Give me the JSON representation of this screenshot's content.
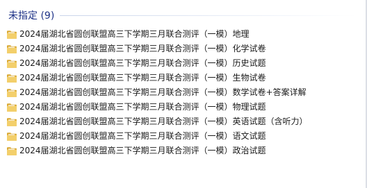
{
  "group": {
    "title": "未指定 (9)"
  },
  "files": [
    {
      "name": "2024届湖北省圆创联盟高三下学期三月联合测评（一模）地理",
      "icon": "folder-icon"
    },
    {
      "name": "2024届湖北省圆创联盟高三下学期三月联合测评（一模）化学试卷",
      "icon": "folder-icon"
    },
    {
      "name": "2024届湖北省圆创联盟高三下学期三月联合测评（一模）历史试题",
      "icon": "folder-icon"
    },
    {
      "name": "2024届湖北省圆创联盟高三下学期三月联合测评（一模）生物试卷",
      "icon": "folder-icon"
    },
    {
      "name": "2024届湖北省圆创联盟高三下学期三月联合测评（一模）数学试卷+答案详解",
      "icon": "folder-icon"
    },
    {
      "name": "2024届湖北省圆创联盟高三下学期三月联合测评（一模）物理试题",
      "icon": "folder-icon"
    },
    {
      "name": "2024届湖北省圆创联盟高三下学期三月联合测评（一模）英语试题（含听力）",
      "icon": "folder-icon"
    },
    {
      "name": "2024届湖北省圆创联盟高三下学期三月联合测评（一模）语文试题",
      "icon": "folder-icon"
    },
    {
      "name": "2024届湖北省圆创联盟高三下学期三月联合测评（一模）政治试题",
      "icon": "folder-icon"
    }
  ],
  "colors": {
    "group_title": "#1e3287",
    "folder_front": "#f3cf6b",
    "folder_back": "#d9a934"
  }
}
